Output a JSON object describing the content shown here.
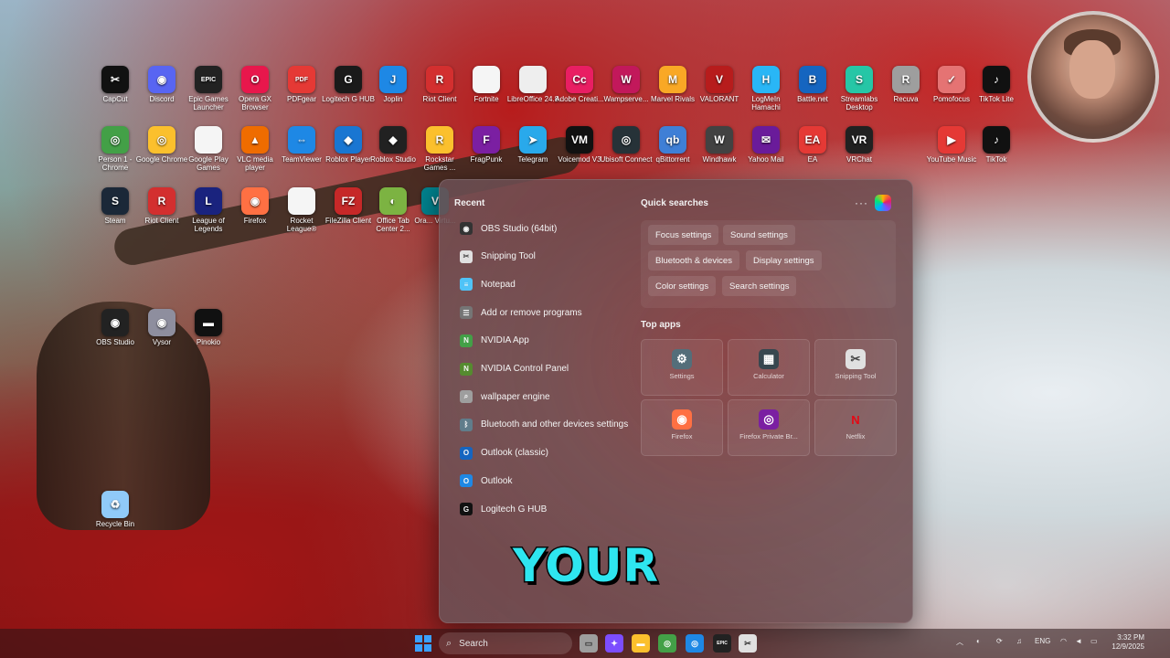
{
  "desktop": {
    "icons": [
      {
        "label": "CapCut",
        "icon": "capcut-icon",
        "color": "#111111",
        "glyph": "✂"
      },
      {
        "label": "Discord",
        "icon": "discord-icon",
        "color": "#5865f2",
        "glyph": "◉"
      },
      {
        "label": "Epic Games Launcher",
        "icon": "epic-games-icon",
        "color": "#222222",
        "glyph": "EPIC"
      },
      {
        "label": "Opera GX Browser",
        "icon": "opera-gx-icon",
        "color": "#e8174c",
        "glyph": "O"
      },
      {
        "label": "PDFgear",
        "icon": "pdfgear-icon",
        "color": "#e53935",
        "glyph": "PDF"
      },
      {
        "label": "Logitech G HUB",
        "icon": "logitech-g-icon",
        "color": "#1a1a1a",
        "glyph": "G"
      },
      {
        "label": "Joplin",
        "icon": "joplin-icon",
        "color": "#1e88e5",
        "glyph": "J"
      },
      {
        "label": "Riot Client",
        "icon": "riot-client-icon",
        "color": "#d32f2f",
        "glyph": "R"
      },
      {
        "label": "Fortnite",
        "icon": "document-icon",
        "color": "#f5f5f5",
        "glyph": ""
      },
      {
        "label": "LibreOffice 24.8",
        "icon": "libreoffice-icon",
        "color": "#eeeeee",
        "glyph": ""
      },
      {
        "label": "Adobe Creati...",
        "icon": "adobe-cc-icon",
        "color": "#e91e63",
        "glyph": "Cc"
      },
      {
        "label": "Wampserve...",
        "icon": "wampserver-icon",
        "color": "#c2185b",
        "glyph": "W"
      },
      {
        "label": "Marvel Rivals",
        "icon": "marvel-rivals-icon",
        "color": "#f9a825",
        "glyph": "M"
      },
      {
        "label": "VALORANT",
        "icon": "valorant-icon",
        "color": "#b71c1c",
        "glyph": "V"
      },
      {
        "label": "LogMeIn Hamachi",
        "icon": "hamachi-icon",
        "color": "#29b6f6",
        "glyph": "H"
      },
      {
        "label": "Battle.net",
        "icon": "battlenet-icon",
        "color": "#1565c0",
        "glyph": "B"
      },
      {
        "label": "Streamlabs Desktop",
        "icon": "streamlabs-icon",
        "color": "#26c6a6",
        "glyph": "S"
      },
      {
        "label": "Recuva",
        "icon": "recuva-icon",
        "color": "#9e9e9e",
        "glyph": "R"
      },
      {
        "label": "Pomofocus",
        "icon": "pomofocus-icon",
        "color": "#e57373",
        "glyph": "✓"
      },
      {
        "label": "TikTok Lite",
        "icon": "tiktok-lite-icon",
        "color": "#111111",
        "glyph": "♪"
      },
      {
        "label": "Person 1 - Chrome",
        "icon": "chrome-profile-icon",
        "color": "#43a047",
        "glyph": "◎"
      },
      {
        "label": "Google Chrome",
        "icon": "chrome-icon",
        "color": "#fbc02d",
        "glyph": "◎"
      },
      {
        "label": "Google Play Games",
        "icon": "document-icon",
        "color": "#f5f5f5",
        "glyph": ""
      },
      {
        "label": "VLC media player",
        "icon": "vlc-icon",
        "color": "#ef6c00",
        "glyph": "▲"
      },
      {
        "label": "TeamViewer",
        "icon": "teamviewer-icon",
        "color": "#1e88e5",
        "glyph": "⇔"
      },
      {
        "label": "Roblox Player",
        "icon": "roblox-player-icon",
        "color": "#1976d2",
        "glyph": "◆"
      },
      {
        "label": "Roblox Studio",
        "icon": "roblox-studio-icon",
        "color": "#212121",
        "glyph": "◆"
      },
      {
        "label": "Rockstar Games ...",
        "icon": "rockstar-icon",
        "color": "#fbc02d",
        "glyph": "R"
      },
      {
        "label": "FragPunk",
        "icon": "fragpunk-icon",
        "color": "#7b1fa2",
        "glyph": "F"
      },
      {
        "label": "Telegram",
        "icon": "telegram-icon",
        "color": "#29a9eb",
        "glyph": "➤"
      },
      {
        "label": "Voicemod V3",
        "icon": "voicemod-icon",
        "color": "#111111",
        "glyph": "VM"
      },
      {
        "label": "Ubisoft Connect",
        "icon": "ubisoft-icon",
        "color": "#263238",
        "glyph": "◎"
      },
      {
        "label": "qBittorrent",
        "icon": "qbittorrent-icon",
        "color": "#3f7fd6",
        "glyph": "qb"
      },
      {
        "label": "Windhawk",
        "icon": "windhawk-icon",
        "color": "#424242",
        "glyph": "W"
      },
      {
        "label": "Yahoo Mail",
        "icon": "yahoo-mail-icon",
        "color": "#6a1b9a",
        "glyph": "✉"
      },
      {
        "label": "EA",
        "icon": "ea-icon",
        "color": "#e53935",
        "glyph": "EA"
      },
      {
        "label": "VRChat",
        "icon": "vrchat-icon",
        "color": "#212121",
        "glyph": "VR"
      },
      {
        "label": "YouTube Music",
        "icon": "youtube-music-icon",
        "color": "#e53935",
        "glyph": "▶"
      },
      {
        "label": "TikTok",
        "icon": "tiktok-icon",
        "color": "#111111",
        "glyph": "♪"
      },
      {
        "label": "Steam",
        "icon": "steam-icon",
        "color": "#1b2838",
        "glyph": "S"
      },
      {
        "label": "Riot Client",
        "icon": "riot-client-icon",
        "color": "#d32f2f",
        "glyph": "R"
      },
      {
        "label": "League of Legends",
        "icon": "league-icon",
        "color": "#1a237e",
        "glyph": "L"
      },
      {
        "label": "Firefox",
        "icon": "firefox-icon",
        "color": "#ff7043",
        "glyph": "◉"
      },
      {
        "label": "Rocket League®",
        "icon": "document-icon",
        "color": "#f5f5f5",
        "glyph": ""
      },
      {
        "label": "FileZilla Client",
        "icon": "filezilla-icon",
        "color": "#c62828",
        "glyph": "FZ"
      },
      {
        "label": "Office Tab Center 2...",
        "icon": "office-tab-icon",
        "color": "#7cb342",
        "glyph": "◐"
      },
      {
        "label": "Ora... Virtu...",
        "icon": "virtualbox-icon",
        "color": "#00838f",
        "glyph": "V"
      },
      {
        "label": "OBS Studio",
        "icon": "obs-icon",
        "color": "#222222",
        "glyph": "◉"
      },
      {
        "label": "Vysor",
        "icon": "vysor-icon",
        "color": "#8e8e9e",
        "glyph": "◉"
      },
      {
        "label": "Pinokio",
        "icon": "pinokio-icon",
        "color": "#111111",
        "glyph": "▬"
      },
      {
        "label": "Recycle Bin",
        "icon": "recycle-bin-icon",
        "color": "#90caf9",
        "glyph": "♻"
      }
    ]
  },
  "start_menu": {
    "recent_title": "Recent",
    "recent": [
      {
        "label": "OBS Studio (64bit)",
        "icon": "obs-icon",
        "color": "#333333",
        "glyph": "◉"
      },
      {
        "label": "Snipping Tool",
        "icon": "snipping-tool-icon",
        "color": "#e0e0e0",
        "glyph": "✂"
      },
      {
        "label": "Notepad",
        "icon": "notepad-icon",
        "color": "#4fc3f7",
        "glyph": "≡"
      },
      {
        "label": "Add or remove programs",
        "icon": "settings-list-icon",
        "color": "#757575",
        "glyph": "☰"
      },
      {
        "label": "NVIDIA App",
        "icon": "nvidia-icon",
        "color": "#43a047",
        "glyph": "N"
      },
      {
        "label": "NVIDIA Control Panel",
        "icon": "nvidia-control-icon",
        "color": "#558b2f",
        "glyph": "N"
      },
      {
        "label": "wallpaper engine",
        "icon": "web-search-icon",
        "color": "#9e9e9e",
        "glyph": "⌕"
      },
      {
        "label": "Bluetooth and other devices settings",
        "icon": "bluetooth-settings-icon",
        "color": "#607d8b",
        "glyph": "ᛒ"
      },
      {
        "label": "Outlook (classic)",
        "icon": "outlook-classic-icon",
        "color": "#1565c0",
        "glyph": "O"
      },
      {
        "label": "Outlook",
        "icon": "outlook-icon",
        "color": "#1e88e5",
        "glyph": "O"
      },
      {
        "label": "Logitech G HUB",
        "icon": "logitech-g-icon",
        "color": "#111111",
        "glyph": "G"
      }
    ],
    "quick_title": "Quick searches",
    "more_label": "···",
    "quick": [
      "Focus settings",
      "Sound settings",
      "Bluetooth & devices",
      "Display settings",
      "Color settings",
      "Search settings"
    ],
    "top_apps_title": "Top apps",
    "top_apps": [
      {
        "label": "Settings",
        "icon": "gear-icon",
        "color": "#546e7a",
        "glyph": "⚙"
      },
      {
        "label": "Calculator",
        "icon": "calculator-icon",
        "color": "#37474f",
        "glyph": "▦"
      },
      {
        "label": "Snipping Tool",
        "icon": "snipping-tool-icon",
        "color": "#e0e0e0",
        "glyph": "✂"
      },
      {
        "label": "Firefox",
        "icon": "firefox-icon",
        "color": "#ff7043",
        "glyph": "◉"
      },
      {
        "label": "Firefox Private Br...",
        "icon": "firefox-private-icon",
        "color": "#7b1fa2",
        "glyph": "◎"
      },
      {
        "label": "Netflix",
        "icon": "netflix-icon",
        "color": "#111111",
        "glyph": "N"
      }
    ]
  },
  "caption": "YOUR",
  "taskbar": {
    "search_placeholder": "Search",
    "apps": [
      {
        "icon": "task-view-icon",
        "color": "#9e9e9e",
        "glyph": "▭"
      },
      {
        "icon": "copilot-icon",
        "color": "#7c4dff",
        "glyph": "✦"
      },
      {
        "icon": "file-explorer-icon",
        "color": "#fbc02d",
        "glyph": "▬"
      },
      {
        "icon": "chrome-icon",
        "color": "#43a047",
        "glyph": "◎"
      },
      {
        "icon": "chrome-profile-icon",
        "color": "#1e88e5",
        "glyph": "◎"
      },
      {
        "icon": "epic-games-icon",
        "color": "#222222",
        "glyph": "EPIC"
      },
      {
        "icon": "snipping-tool-icon",
        "color": "#e0e0e0",
        "glyph": "✂"
      }
    ],
    "language": "ENG",
    "time": "3:32 PM",
    "date": "12/9/2025"
  }
}
